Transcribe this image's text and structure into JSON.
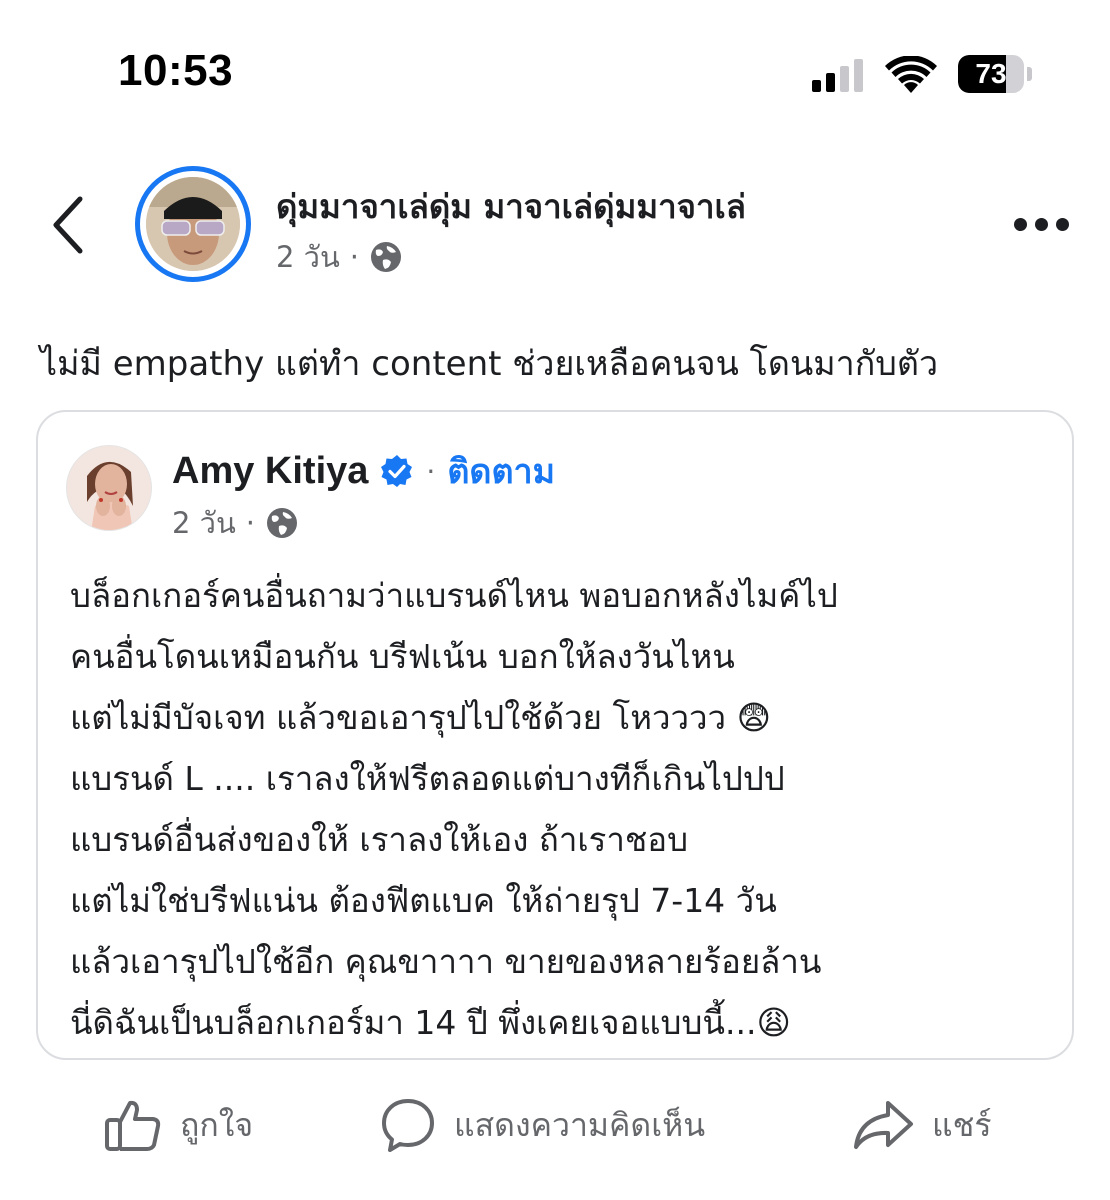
{
  "status_bar": {
    "time": "10:53",
    "battery_level": "73",
    "signal_bars_filled": 2,
    "signal_bars_total": 4
  },
  "post": {
    "author": "ดุ่มมาจาเล่ดุ่ม มาจาเล่ดุ่มมาจาเล่",
    "time": "2 วัน",
    "separator": "·",
    "privacy_icon": "globe-icon",
    "caption": "ไม่มี empathy แต่ทำ content ช่วยเหลือคนจน โดนมากับตัว"
  },
  "shared_post": {
    "author": "Amy Kitiya",
    "verified_icon": "verified-badge-icon",
    "separator": "·",
    "follow_label": "ติดตาม",
    "time": "2 วัน",
    "privacy_icon": "globe-icon",
    "lines": [
      "บล็อกเกอร์คนอื่นถามว่าแบรนด์ไหน พอบอกหลังไมค์ไป",
      "คนอื่นโดนเหมือนกัน บรีฟเน้น บอกให้ลงวันไหน",
      "แต่ไม่มีบัจเจท แล้วขอเอารุปไปใช้ด้วย โหวววว 😨",
      "แบรนด์ L  ....  เราลงให้ฟรีตลอดแต่บางทีก็เกินไปปป",
      "แบรนด์อื่นส่งของให้ เราลงให้เอง ถ้าเราชอบ",
      "แต่ไม่ใช่บรีฟแน่น ต้องฟีตแบค ให้ถ่ายรุป 7-14 วัน",
      "แล้วเอารุปไปใช้อีก คุณขาาาา ขายของหลายร้อยล้าน",
      "นี่ดิฉันเป็นบล็อกเกอร์มา 14 ปี พึ่งเคยเจอแบบนี้...😩"
    ]
  },
  "actions": {
    "like_label": "ถูกใจ",
    "comment_label": "แสดงความคิดเห็น",
    "share_label": "แชร์"
  },
  "colors": {
    "accent": "#1877f2",
    "text": "#1c1e21",
    "muted": "#65676b",
    "card_border": "#dcdde0"
  }
}
